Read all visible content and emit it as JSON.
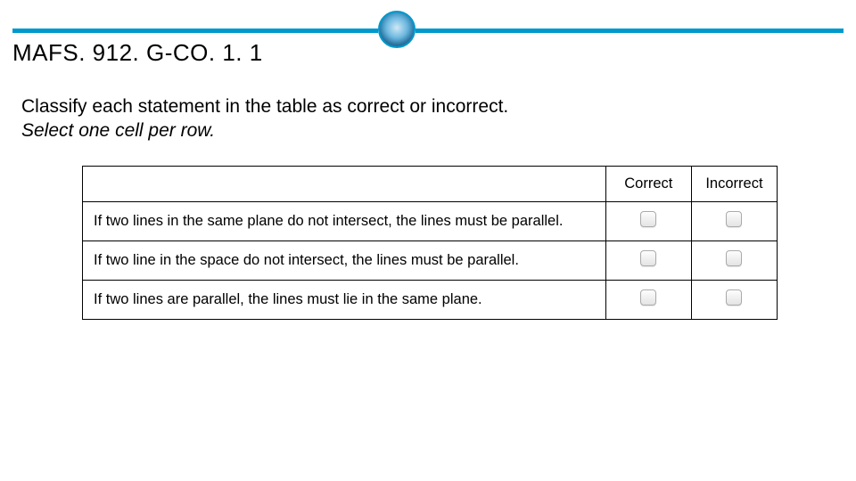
{
  "title": "MAFS. 912. G-CO. 1. 1",
  "instruction_line1": "Classify each statement in the table as correct or incorrect.",
  "instruction_line2": "Select one cell per row.",
  "columns": {
    "correct": "Correct",
    "incorrect": "Incorrect"
  },
  "rows": [
    {
      "statement": "If two lines in the same plane do not intersect, the lines must be parallel."
    },
    {
      "statement": "If two line in the space do not intersect, the lines must be parallel."
    },
    {
      "statement": "If two lines are parallel, the lines must lie in the same plane."
    }
  ]
}
